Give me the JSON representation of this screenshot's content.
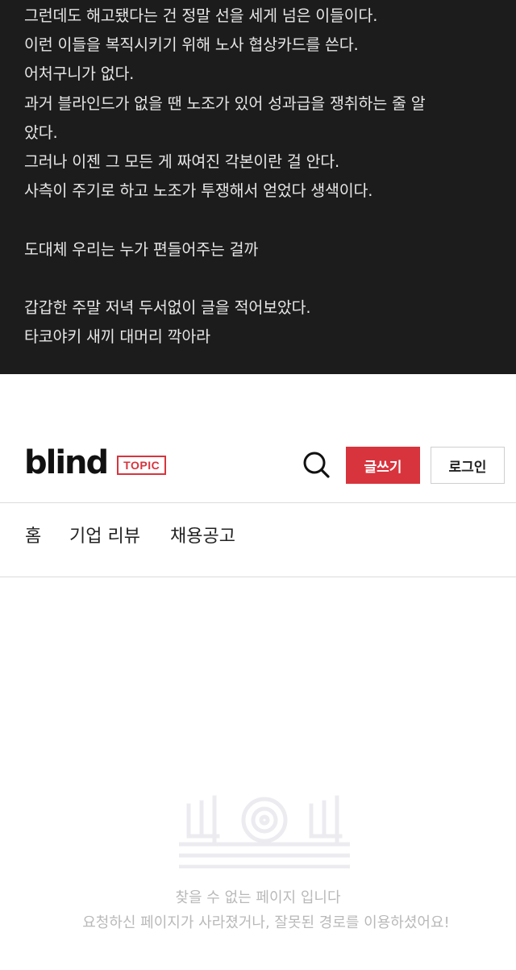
{
  "post": {
    "lines": [
      "그런데도 해고됐다는 건 정말 선을 세게 넘은 이들이다.",
      "이런 이들을 복직시키기 위해 노사 협상카드를 쓴다.",
      "어처구니가 없다.",
      "과거 블라인드가 없을 땐 노조가 있어 성과급을 쟁취하는 줄 알",
      "았다.",
      "그러나 이젠 그 모든 게 짜여진 각본이란 걸 안다.",
      "사측이 주기로 하고 노조가 투쟁해서 얻었다 생색이다.",
      "",
      "도대체 우리는 누가 편들어주는 걸까",
      "",
      "갑갑한 주말 저녁 두서없이 글을 적어보았다.",
      "타코야키 새끼 대머리 깍아라"
    ]
  },
  "header": {
    "logo_text": "blind",
    "topic_badge": "TOPIC",
    "write_label": "글쓰기",
    "login_label": "로그인",
    "accent_color": "#d8343d"
  },
  "nav": {
    "items": [
      "홈",
      "기업 리뷰",
      "채용공고"
    ]
  },
  "error": {
    "title": "찾을 수 없는 페이지 입니다",
    "description": "요청하신 페이지가 사라졌거나, 잘못된 경로를 이용하셨어요!"
  }
}
